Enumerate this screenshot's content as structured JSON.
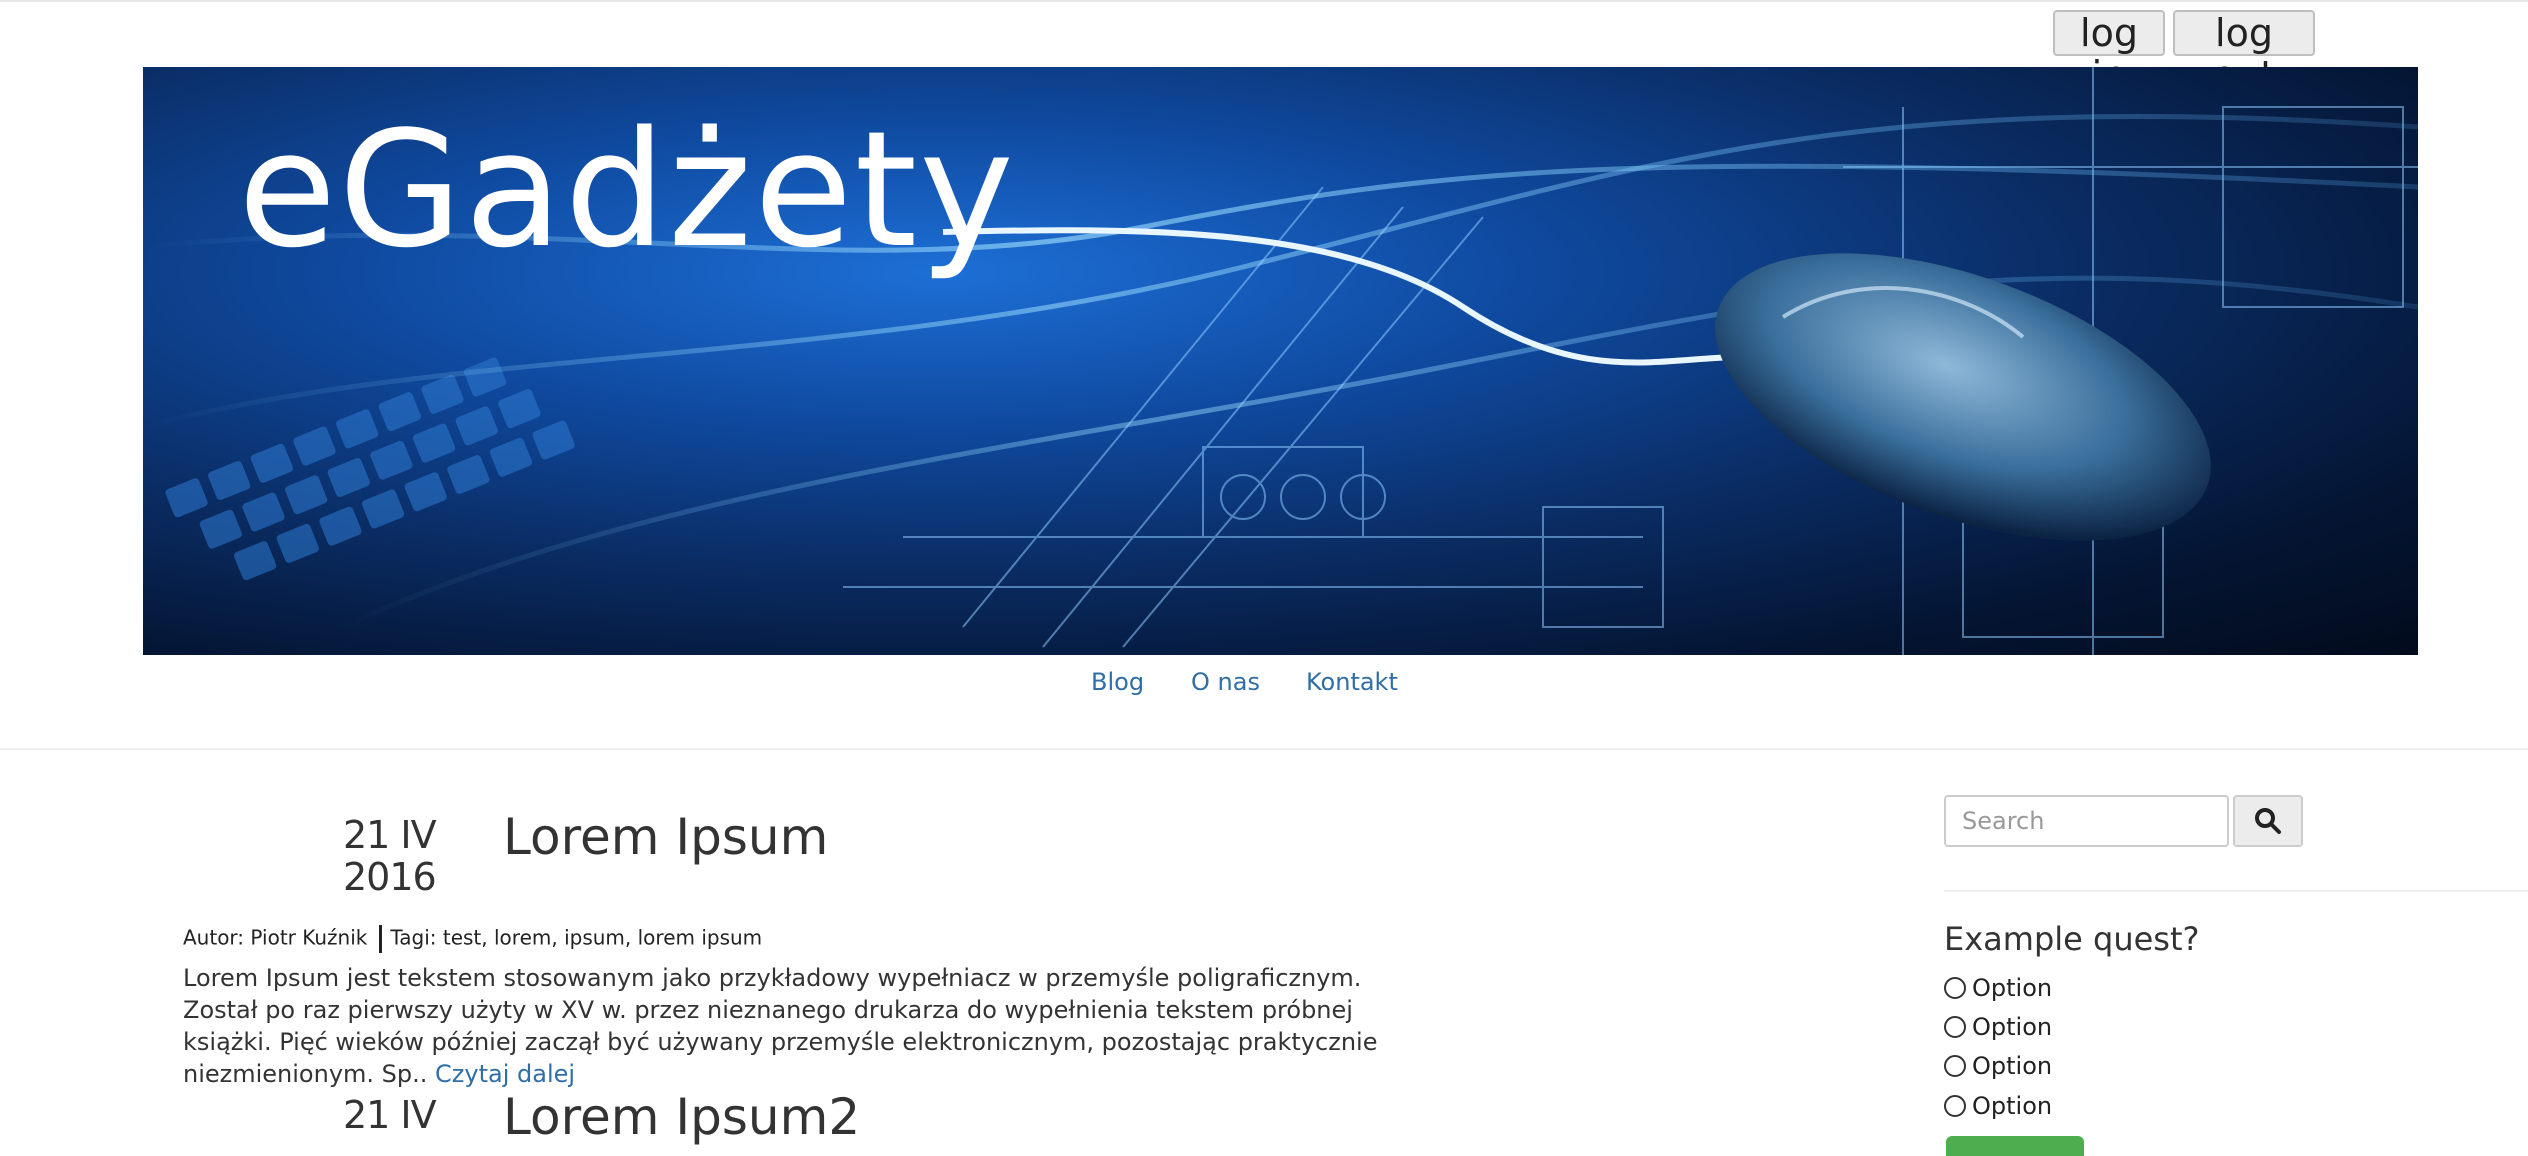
{
  "auth": {
    "login_label": "log in",
    "logout_label": "log out"
  },
  "header": {
    "brand": "eGadżety"
  },
  "nav": {
    "items": [
      {
        "label": "Blog"
      },
      {
        "label": "O nas"
      },
      {
        "label": "Kontakt"
      }
    ]
  },
  "posts": [
    {
      "date_day": "21 IV",
      "date_year": "2016",
      "title": "Lorem Ipsum",
      "author": "Autor: Piotr Kuźnik",
      "tags": "Tagi: test, lorem, ipsum, lorem ipsum",
      "excerpt": "Lorem Ipsum jest tekstem stosowanym jako przykładowy wypełniacz w przemyśle poligraficznym. Został po raz pierwszy użyty w XV w. przez nieznanego drukarza do wypełnienia tekstem próbnej książki. Pięć wieków później zaczął być używany przemyśle elektronicznym, pozostając praktycznie niezmienionym. Sp..",
      "read_more": "Czytaj dalej"
    },
    {
      "date_day": "21 IV",
      "title": "Lorem Ipsum2"
    }
  ],
  "sidebar": {
    "search": {
      "placeholder": "Search"
    },
    "quiz": {
      "title": "Example quest?",
      "options": [
        {
          "label": "Option"
        },
        {
          "label": "Option"
        },
        {
          "label": "Option"
        },
        {
          "label": "Option"
        }
      ]
    }
  },
  "colors": {
    "link": "#2f6ea6",
    "submit": "#4cae4c",
    "banner_blue": "#0f4aa0"
  }
}
